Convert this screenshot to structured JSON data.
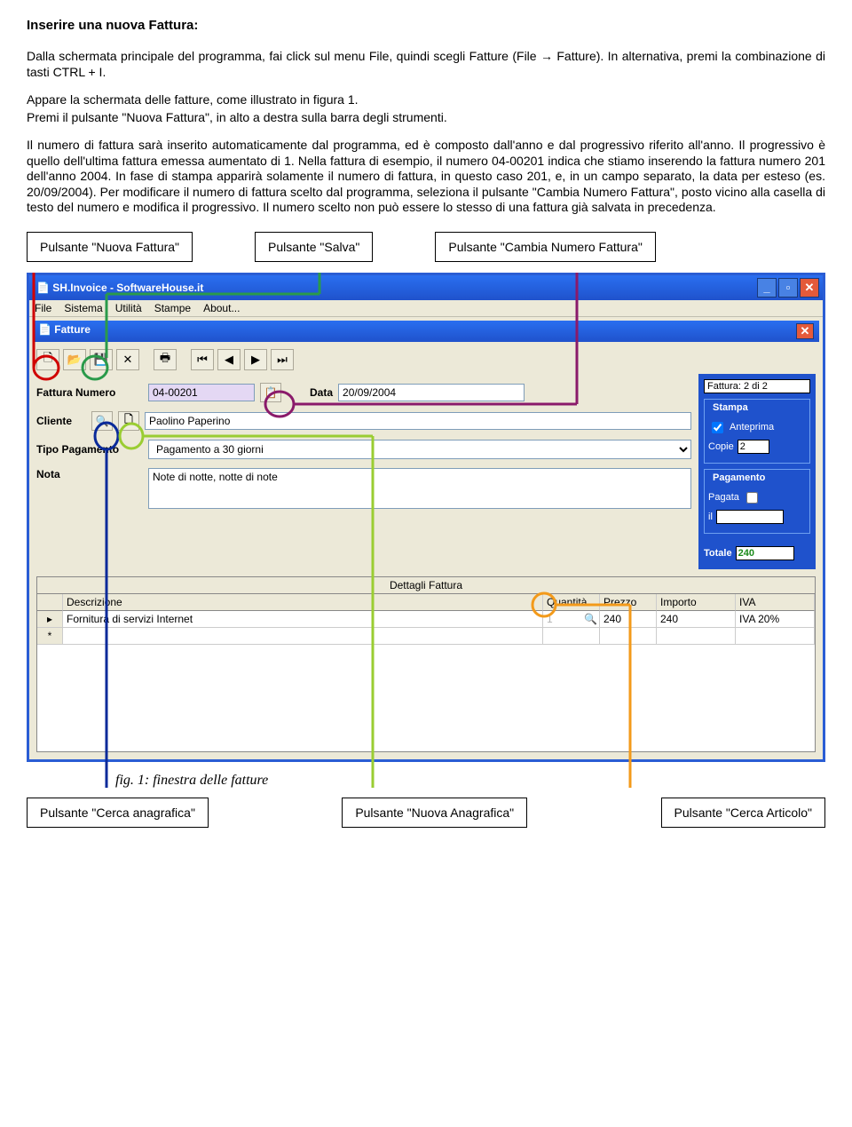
{
  "doc": {
    "title": "Inserire una nuova Fattura:",
    "p1": "Dalla schermata principale del programma, fai click sul menu File, quindi scegli Fatture (File → Fatture). In alternativa, premi la combinazione di tasti CTRL + I.",
    "p2": "Appare la schermata delle fatture, come illustrato in figura 1.",
    "p3": "Premi il pulsante \"Nuova Fattura\", in alto a destra sulla barra degli strumenti.",
    "p4": "Il numero di fattura sarà inserito automaticamente dal programma, ed è composto dall'anno e dal progressivo riferito all'anno. Il progressivo è quello dell'ultima fattura emessa aumentato di 1. Nella fattura di esempio, il numero 04-00201 indica che stiamo inserendo la fattura numero 201 dell'anno 2004. In fase di stampa apparirà solamente il numero di fattura, in questo caso 201, e, in un campo separato, la data per esteso (es. 20/09/2004).  Per modificare il numero di fattura scelto dal programma, seleziona il pulsante \"Cambia Numero Fattura\", posto vicino alla casella di testo del numero e modifica il progressivo. Il numero scelto non può essere lo stesso di una fattura già salvata in precedenza."
  },
  "callouts": {
    "top1": "Pulsante \"Nuova Fattura\"",
    "top2": "Pulsante \"Salva\"",
    "top3": "Pulsante \"Cambia Numero Fattura\"",
    "bot1": "Pulsante \"Cerca anagrafica\"",
    "bot2": "Pulsante \"Nuova Anagrafica\"",
    "bot3": "Pulsante \"Cerca Articolo\""
  },
  "app": {
    "title": "SH.Invoice - SoftwareHouse.it",
    "menu": [
      "File",
      "Sistema",
      "Utilità",
      "Stampe",
      "About..."
    ],
    "subtitle": "Fatture",
    "counter": "Fattura: 2 di 2",
    "fields": {
      "fattura_numero_label": "Fattura Numero",
      "fattura_numero_value": "04-00201",
      "data_label": "Data",
      "data_value": "20/09/2004",
      "cliente_label": "Cliente",
      "cliente_value": "Paolino Paperino",
      "tipo_pag_label": "Tipo Pagamento",
      "tipo_pag_value": "Pagamento a 30 giorni",
      "nota_label": "Nota",
      "nota_value": "Note di notte, notte di note"
    },
    "right": {
      "stampa_title": "Stampa",
      "anteprima": "Anteprima",
      "copie_label": "Copie",
      "copie_value": "2",
      "pagamento_title": "Pagamento",
      "pagata_label": "Pagata",
      "il_label": "il",
      "totale_label": "Totale",
      "totale_value": "240"
    },
    "grid": {
      "title": "Dettagli Fattura",
      "headers": [
        "Descrizione",
        "Quantità",
        "Prezzo",
        "Importo",
        "IVA"
      ],
      "row1": {
        "desc": "Fornitura di servizi Internet",
        "qty": "1",
        "price": "240",
        "importo": "240",
        "iva": "IVA 20%"
      }
    }
  },
  "caption": "fig. 1: finestra delle fatture"
}
